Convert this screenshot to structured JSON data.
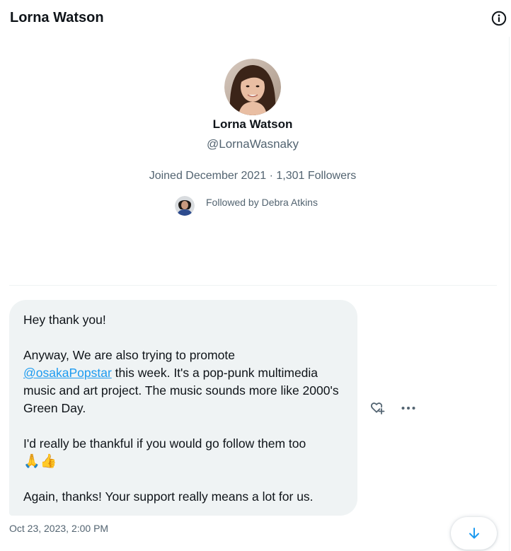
{
  "header": {
    "title": "Lorna Watson",
    "info_icon": "info-icon"
  },
  "profile": {
    "name": "Lorna Watson",
    "handle": "@LornaWasnaky",
    "meta": "Joined December 2021 · 1,301 Followers",
    "followed_by": "Followed by Debra Atkins"
  },
  "message": {
    "line1": "Hey thank you!",
    "line2_start": "Anyway, We are also trying to promote",
    "mention": "@osakaPopstar",
    "line2_rest": " this week. It's a pop-punk multimedia music and art project. The music sounds more like 2000's Green Day.",
    "line3": "I'd really be thankful if you would go follow them too",
    "emojis": "🙏👍",
    "line4": "Again, thanks! Your support really means a lot for us.",
    "timestamp": "Oct 23, 2023, 2:00 PM"
  },
  "colors": {
    "accent": "#1d9bf0",
    "bubble_bg": "#eff3f4",
    "secondary_text": "#536471",
    "primary_text": "#0f1419"
  },
  "icons": {
    "react": "heart-plus-icon",
    "more": "more-icon",
    "scroll": "arrow-down-icon"
  }
}
